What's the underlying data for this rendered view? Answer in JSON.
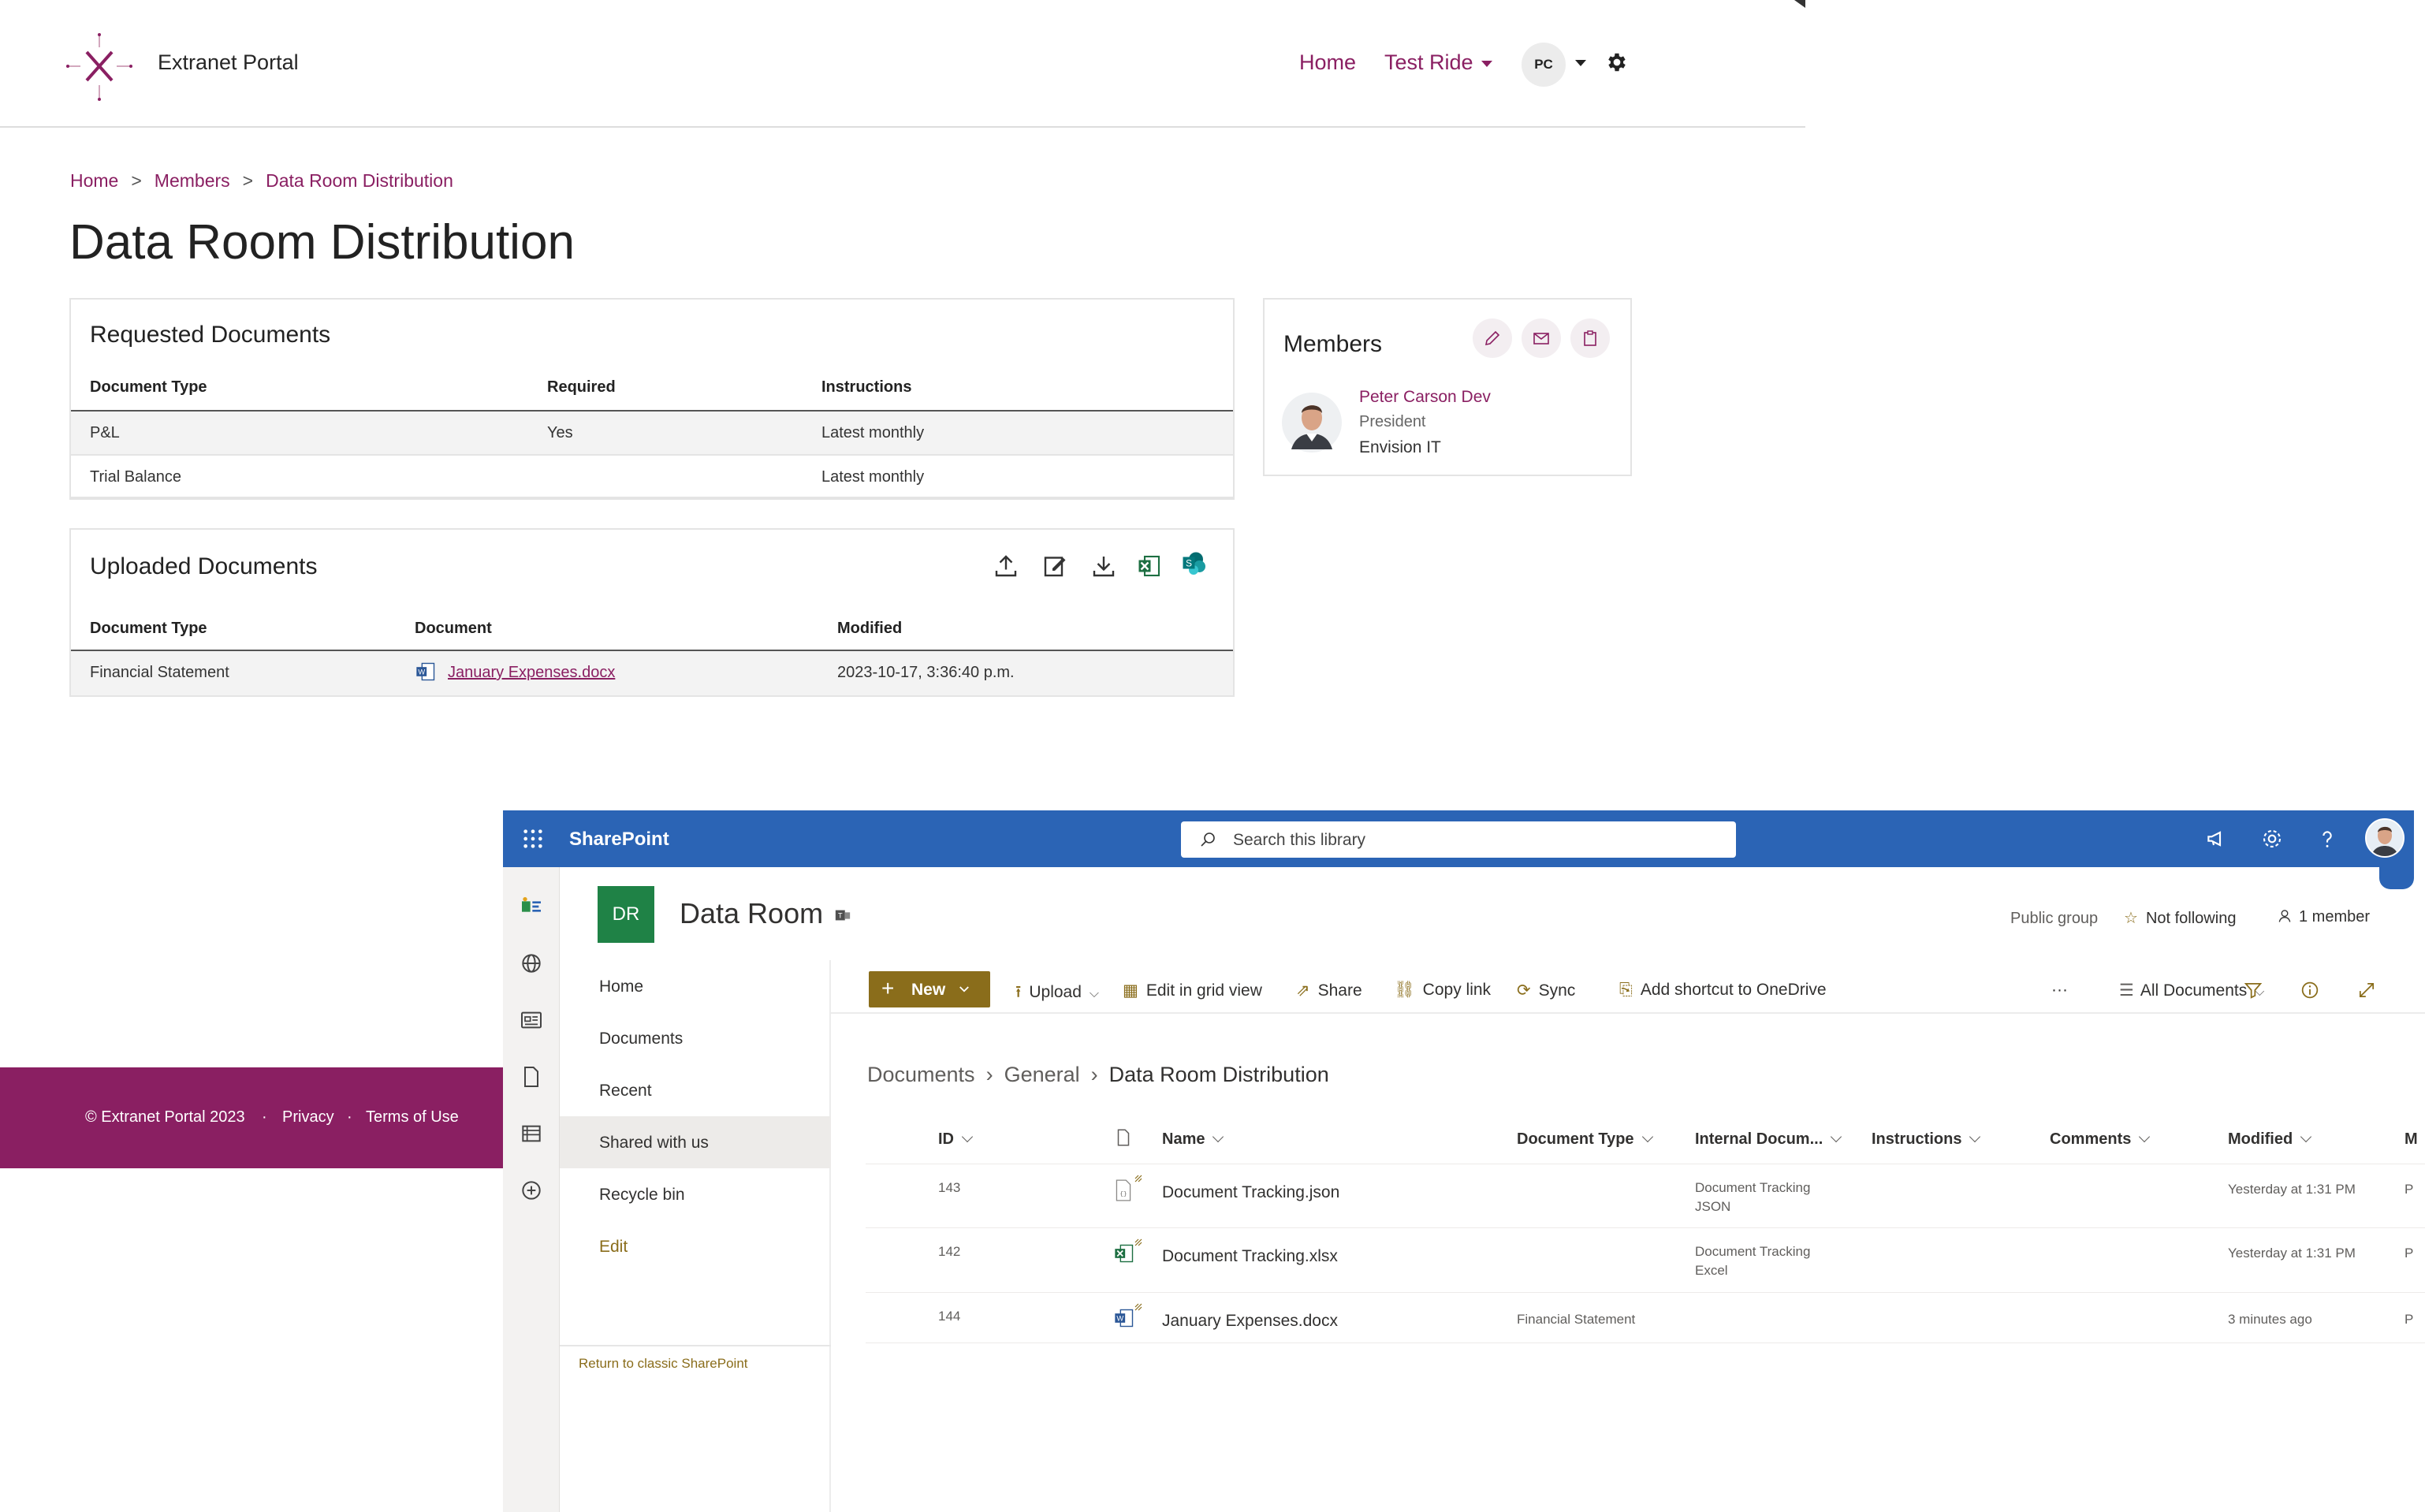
{
  "portal": {
    "brand": "Extranet Portal",
    "nav": {
      "home": "Home",
      "test_ride": "Test Ride"
    },
    "user_initials": "PC",
    "breadcrumb": [
      "Home",
      "Members",
      "Data Room Distribution"
    ],
    "breadcrumb_sep": ">",
    "page_title": "Data Room Distribution",
    "requested": {
      "title": "Requested Documents",
      "columns": [
        "Document Type",
        "Required",
        "Instructions"
      ],
      "rows": [
        {
          "type": "P&L",
          "required": "Yes",
          "instructions": "Latest monthly"
        },
        {
          "type": "Trial Balance",
          "required": "",
          "instructions": "Latest monthly"
        }
      ]
    },
    "uploaded": {
      "title": "Uploaded Documents",
      "columns": [
        "Document Type",
        "Document",
        "Modified"
      ],
      "rows": [
        {
          "type": "Financial Statement",
          "document": "January Expenses.docx",
          "modified": "2023-10-17, 3:36:40 p.m."
        }
      ],
      "toolbar_icons": [
        "upload-icon",
        "edit-icon",
        "download-icon",
        "excel-icon",
        "sharepoint-icon"
      ]
    },
    "members": {
      "title": "Members",
      "person": {
        "name": "Peter Carson Dev",
        "role": "President",
        "company": "Envision IT"
      },
      "action_icons": [
        "pencil-icon",
        "mail-icon",
        "clipboard-icon"
      ]
    },
    "footer": {
      "copyright": "© Extranet Portal 2023",
      "dot": "·",
      "privacy": "Privacy",
      "terms": "Terms of Use"
    },
    "colors": {
      "accent": "#8a1f62",
      "footer_bg": "#8a1f62"
    }
  },
  "sharepoint": {
    "brand": "SharePoint",
    "search_placeholder": "Search this library",
    "site": {
      "logo": "DR",
      "title": "Data Room",
      "public_group": "Public group",
      "follow": "Not following",
      "members": "1 member"
    },
    "nav": [
      "Home",
      "Documents",
      "Recent",
      "Shared with us",
      "Recycle bin",
      "Edit"
    ],
    "nav_selected": "Shared with us",
    "return_classic": "Return to classic SharePoint",
    "commands": {
      "new": "New",
      "upload": "Upload",
      "grid": "Edit in grid view",
      "share": "Share",
      "copy_link": "Copy link",
      "sync": "Sync",
      "shortcut": "Add shortcut to OneDrive",
      "more": "···",
      "view": "All Documents"
    },
    "library_breadcrumb": [
      "Documents",
      "General",
      "Data Room Distribution"
    ],
    "columns": [
      "ID",
      "Name",
      "Document Type",
      "Internal Docum...",
      "Instructions",
      "Comments",
      "Modified",
      "M"
    ],
    "rows": [
      {
        "id": "143",
        "name": "Document Tracking.json",
        "doc_type": "",
        "internal_1": "Document Tracking",
        "internal_2": "JSON",
        "modified": "Yesterday at 1:31 PM",
        "extra": "P",
        "icon": "json-file-icon"
      },
      {
        "id": "142",
        "name": "Document Tracking.xlsx",
        "doc_type": "",
        "internal_1": "Document Tracking",
        "internal_2": "Excel",
        "modified": "Yesterday at 1:31 PM",
        "extra": "P",
        "icon": "excel-file-icon"
      },
      {
        "id": "144",
        "name": "January Expenses.docx",
        "doc_type": "Financial Statement",
        "internal_1": "",
        "internal_2": "",
        "modified": "3 minutes ago",
        "extra": "P",
        "icon": "word-file-icon"
      }
    ],
    "colors": {
      "suite_bar": "#2b64b5",
      "site_logo": "#1f8246",
      "new_button": "#8a6d1b"
    }
  }
}
